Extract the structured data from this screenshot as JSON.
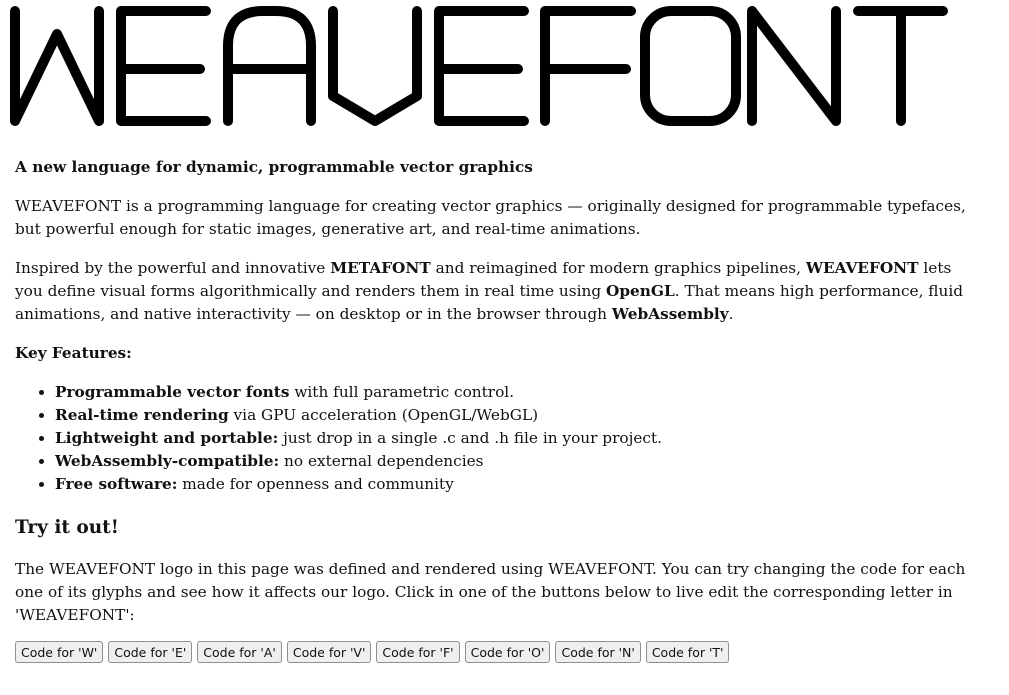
{
  "logo": {
    "text": "WEAVEFONT",
    "color": "#000000"
  },
  "tagline": "A new language for dynamic, programmable vector graphics",
  "intro": "WEAVEFONT is a programming language for creating vector graphics — originally designed for programmable typefaces, but powerful enough for static images, generative art, and real-time animations.",
  "inspired": {
    "t1": "Inspired by the powerful and innovative ",
    "b1": "METAFONT",
    "t2": " and reimagined for modern graphics pipelines, ",
    "b2": "WEAVEFONT",
    "t3": " lets you define visual forms algorithmically and renders them in real time using ",
    "b3": "OpenGL",
    "t4": ". That means high performance, fluid animations, and native interactivity — on desktop or in the browser through ",
    "b4": "WebAssembly",
    "t5": "."
  },
  "features_heading": "Key Features:",
  "features": [
    {
      "bold": "Programmable vector fonts",
      "text": " with full parametric control."
    },
    {
      "bold": "Real-time rendering",
      "text": " via GPU acceleration (OpenGL/WebGL)"
    },
    {
      "bold": "Lightweight and portable:",
      "text": " just drop in a single .c and .h file in your project."
    },
    {
      "bold": "WebAssembly-compatible:",
      "text": " no external dependencies"
    },
    {
      "bold": "Free software:",
      "text": " made for openness and community"
    }
  ],
  "try_heading": "Try it out!",
  "try_text": "The WEAVEFONT logo in this page was defined and rendered using WEAVEFONT. You can try changing the code for each one of its glyphs and see how it affects our logo. Click in one of the buttons below to live edit the corresponding letter in 'WEAVEFONT':",
  "buttons": [
    "Code for 'W'",
    "Code for 'E'",
    "Code for 'A'",
    "Code for 'V'",
    "Code for 'F'",
    "Code for 'O'",
    "Code for 'N'",
    "Code for 'T'"
  ]
}
